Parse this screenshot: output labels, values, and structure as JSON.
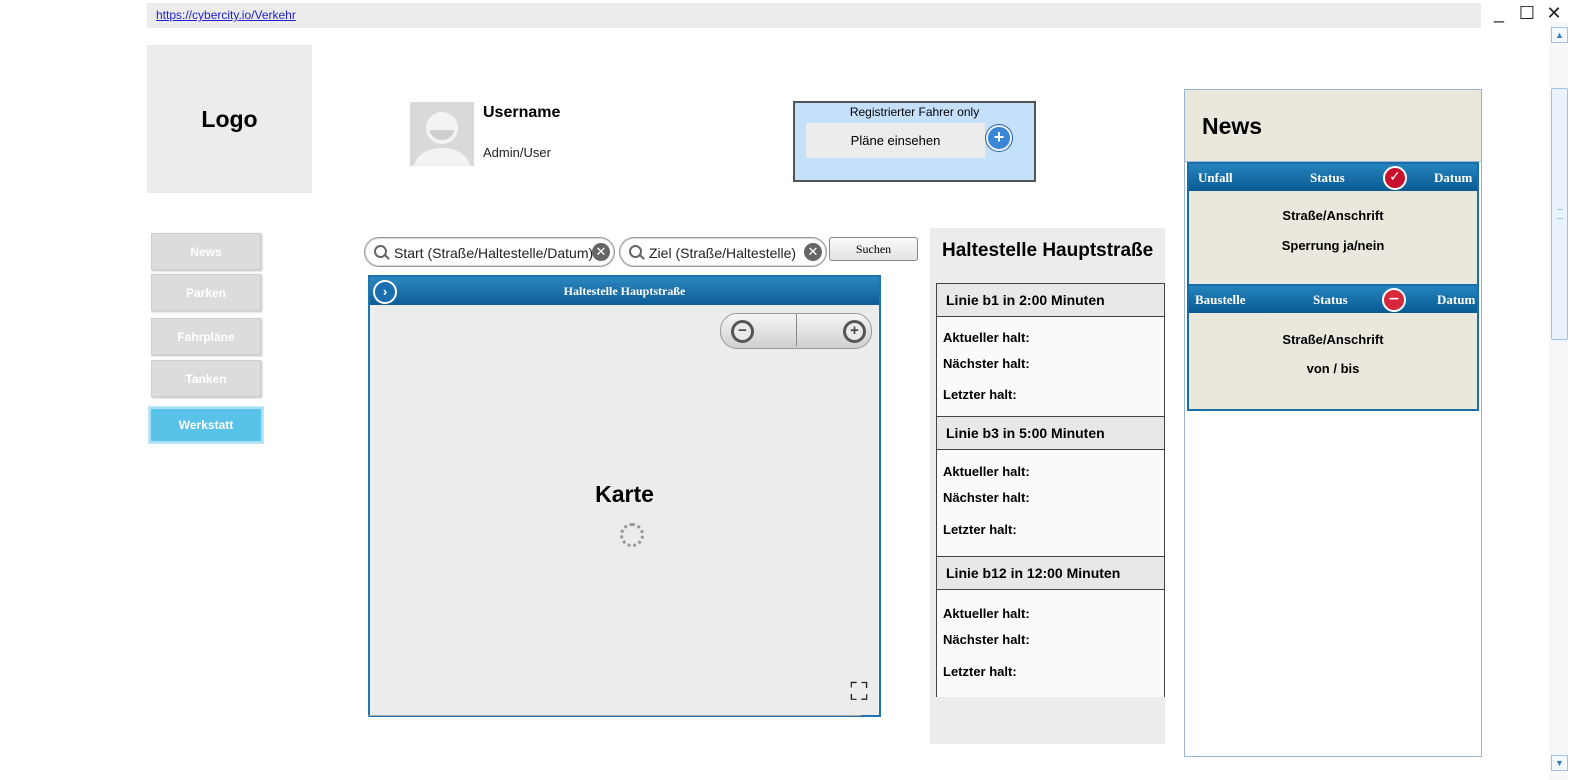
{
  "browser": {
    "url": "https://cybercity.io/Verkehr"
  },
  "header": {
    "logo": "Logo",
    "user": {
      "name": "Username",
      "role": "Admin/User"
    },
    "registered": {
      "title": "Registrierter Fahrer only",
      "button": "Pläne einsehen"
    }
  },
  "nav": {
    "items": [
      {
        "label": "News",
        "active": false
      },
      {
        "label": "Parken",
        "active": false
      },
      {
        "label": "Fahrpläne",
        "active": false
      },
      {
        "label": "Tanken",
        "active": false
      },
      {
        "label": "Werkstatt",
        "active": true
      }
    ]
  },
  "search": {
    "start": "Start (Straße/Haltestelle/Datum)",
    "ziel": "Ziel (Straße/Haltestelle)",
    "button": "Suchen"
  },
  "map": {
    "title": "Haltestelle Hauptstraße",
    "label": "Karte"
  },
  "stop": {
    "title": "Haltestelle Hauptstraße",
    "lines": [
      {
        "header": "Linie b1 in 2:00 Minuten",
        "current": "Aktueller halt:",
        "next": "Nächster halt:",
        "last": "Letzter halt:"
      },
      {
        "header": "Linie b3 in 5:00 Minuten",
        "current": "Aktueller halt:",
        "next": "Nächster halt:",
        "last": "Letzter halt:"
      },
      {
        "header": "Linie b12 in 12:00 Minuten",
        "current": "Aktueller halt:",
        "next": "Nächster halt:",
        "last": "Letzter halt:"
      }
    ]
  },
  "news": {
    "title": "News",
    "cards": [
      {
        "type": "Unfall",
        "status": "Status",
        "date": "Datum",
        "line1": "Straße/Anschrift",
        "line2": "Sperrung ja/nein",
        "icon": "check-icon",
        "color": "#c8102e"
      },
      {
        "type": "Baustelle",
        "status": "Status",
        "date": "Datum",
        "line1": "Straße/Anschrift",
        "line2": "von / bis",
        "icon": "minus-icon",
        "color": "#d6283b"
      }
    ]
  }
}
